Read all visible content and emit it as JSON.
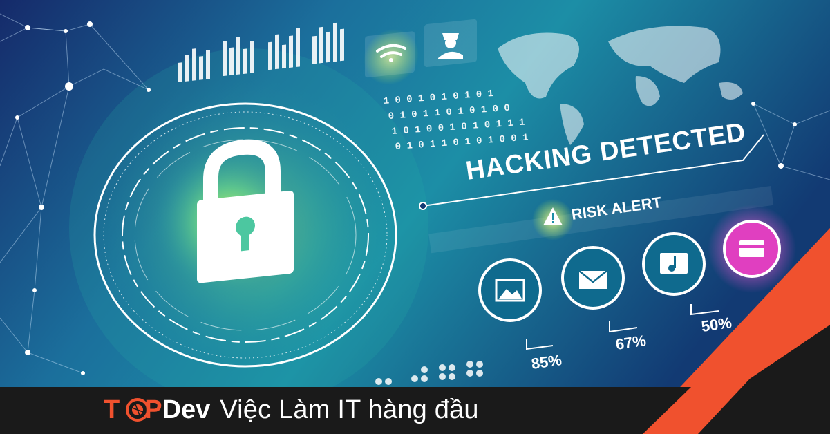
{
  "headline": "HACKING DETECTED",
  "alert": "RISK ALERT",
  "binary_rows": [
    "1 0 0 1 0 1 0 1 0 1",
    "0 1 0 1 1 0 1 0 1 0 0",
    "1 0 1 0 0 1 0 1 0 1 1 1",
    "0 1 0 1 1 0 1 0 1 0 0 1"
  ],
  "stats": [
    {
      "icon": "image-icon",
      "value": "85%"
    },
    {
      "icon": "mail-icon",
      "value": "67%"
    },
    {
      "icon": "music-file-icon",
      "value": "50%"
    },
    {
      "icon": "credit-card-icon",
      "value": ""
    }
  ],
  "brand": {
    "letter_t": "T",
    "letter_p": "P",
    "suffix": "Dev",
    "tagline": "Việc Làm IT hàng đầu"
  },
  "colors": {
    "brand_orange": "#f0512e",
    "bar_dark": "#1a1a1a",
    "glow_green": "#b6ff3a",
    "glow_pink": "#ff4fd8"
  }
}
